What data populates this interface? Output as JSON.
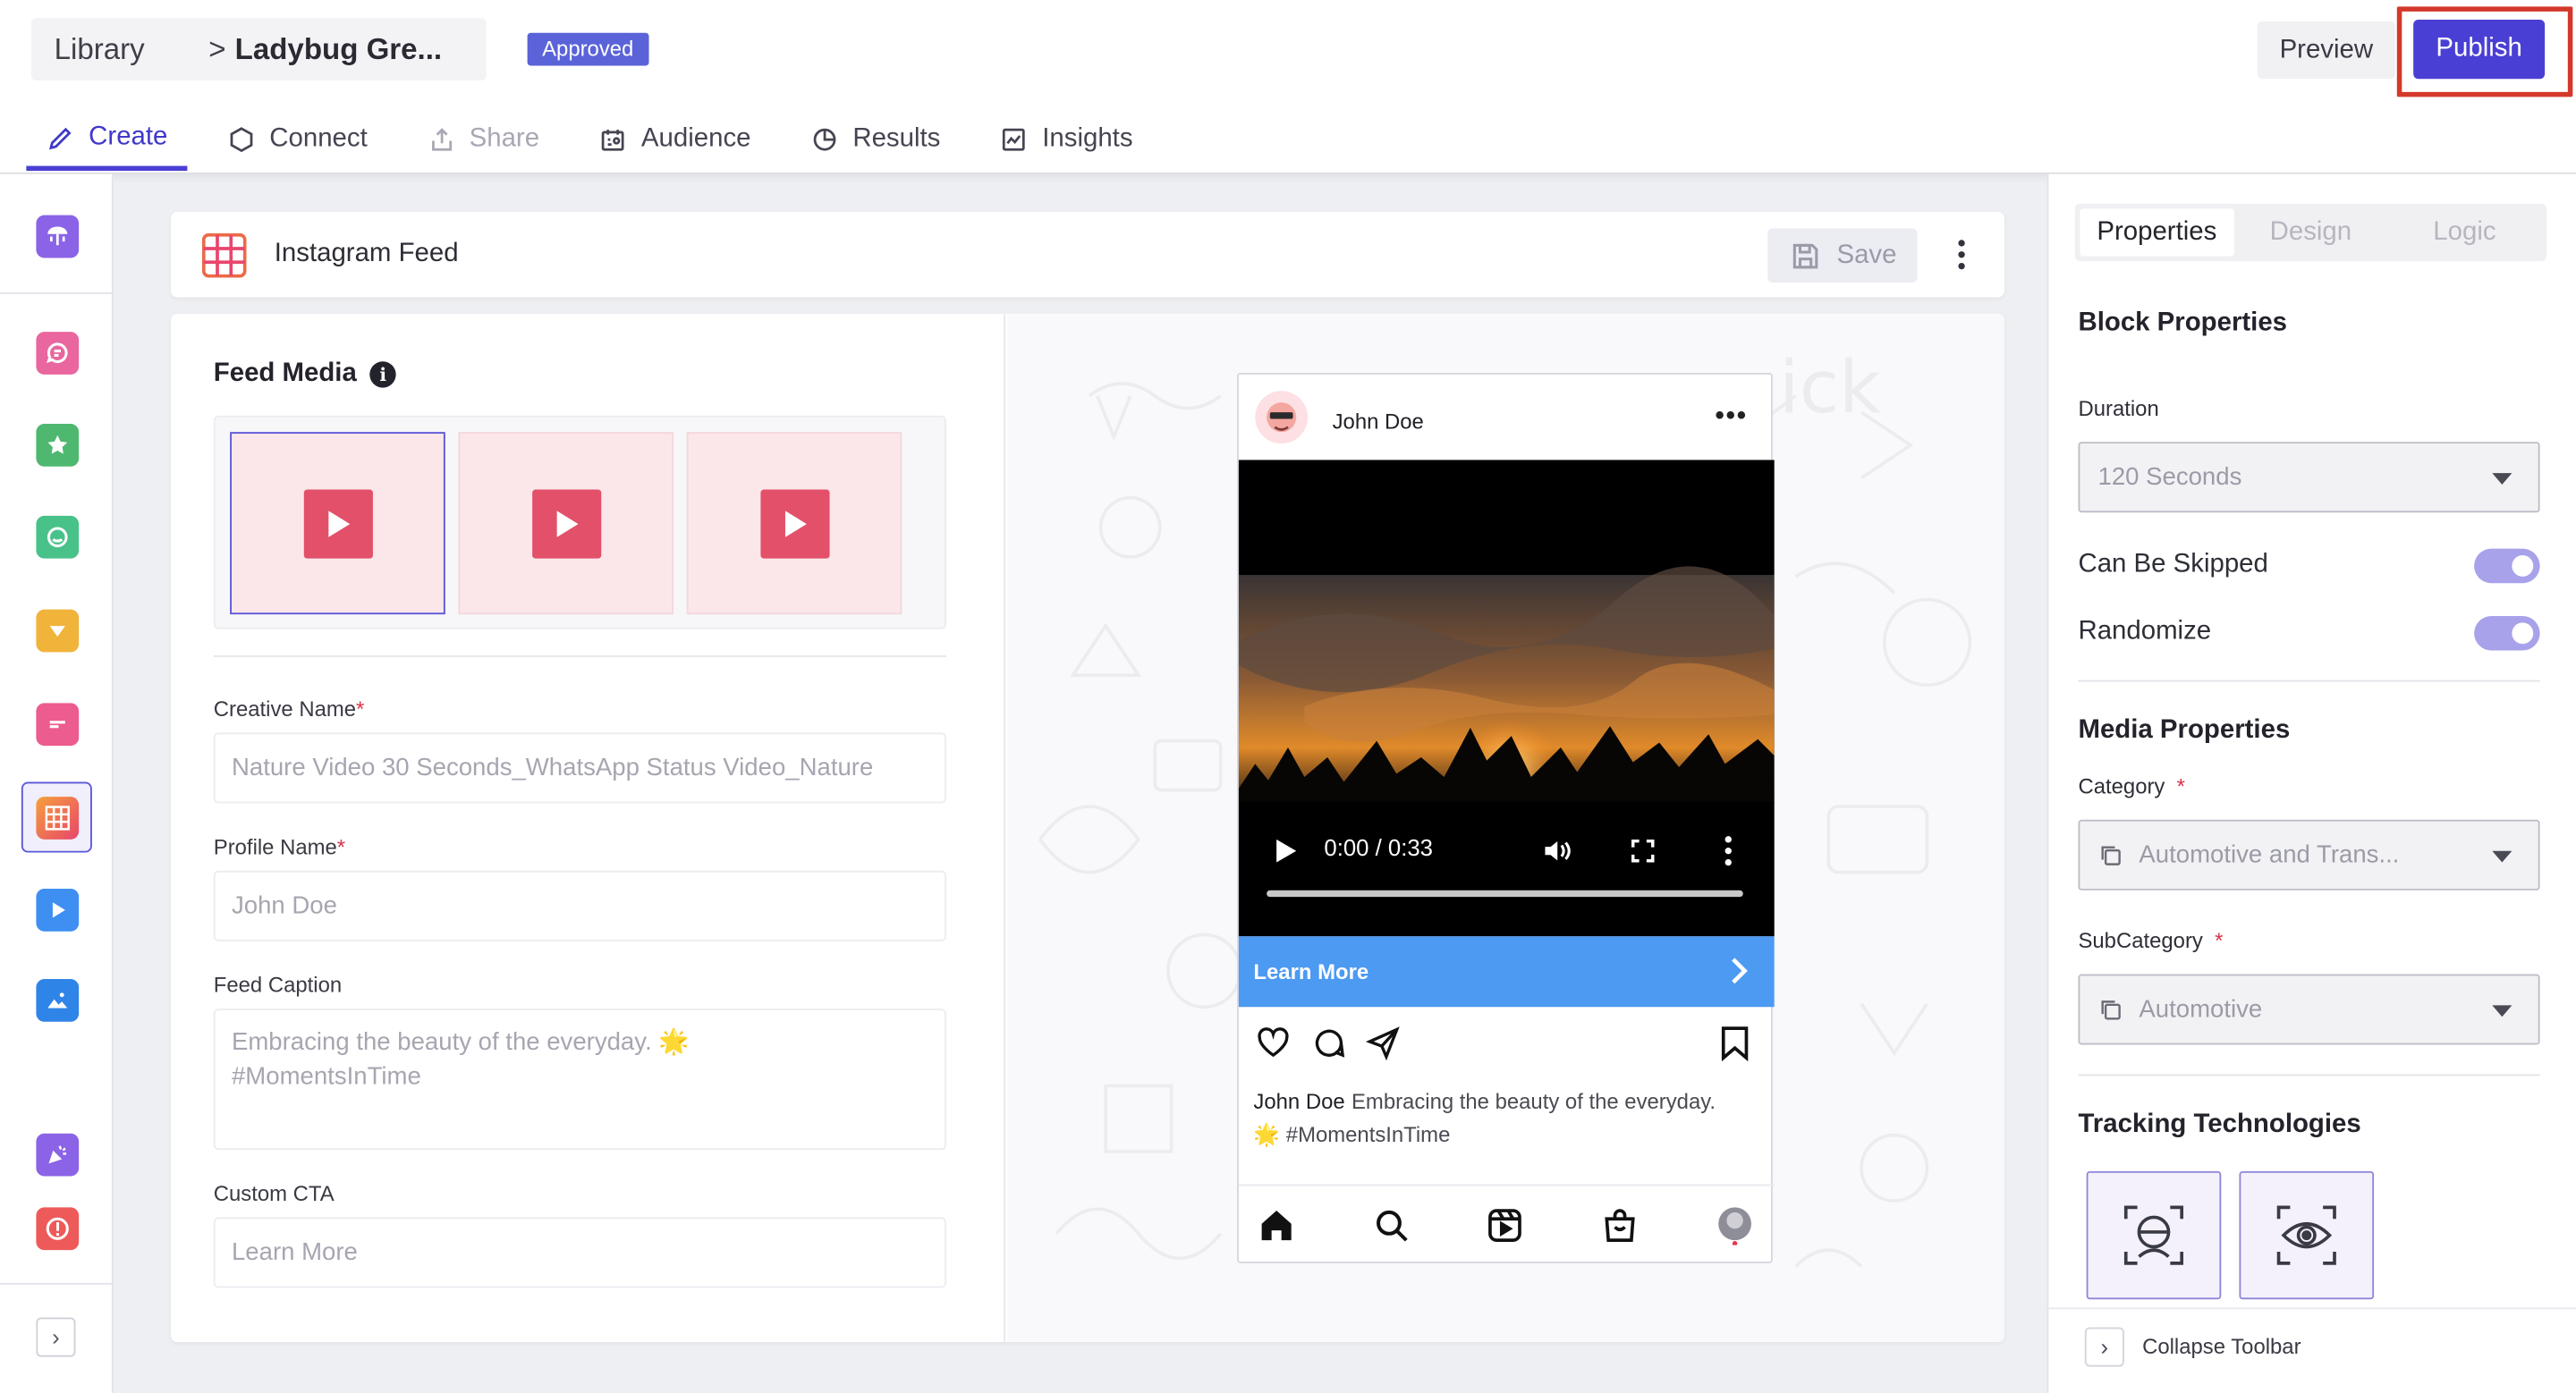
{
  "header": {
    "breadcrumb_root": "Library",
    "breadcrumb_separator": ">",
    "breadcrumb_current": "Ladybug Gre...",
    "status": "Approved",
    "preview_label": "Preview",
    "publish_label": "Publish"
  },
  "tabs": [
    {
      "label": "Create",
      "icon": "pencil-icon",
      "state": "active"
    },
    {
      "label": "Connect",
      "icon": "hexagon-icon",
      "state": "normal"
    },
    {
      "label": "Share",
      "icon": "share-icon",
      "state": "disabled"
    },
    {
      "label": "Audience",
      "icon": "audience-icon",
      "state": "normal"
    },
    {
      "label": "Results",
      "icon": "pie-chart-icon",
      "state": "normal"
    },
    {
      "label": "Insights",
      "icon": "insights-chart-icon",
      "state": "normal"
    }
  ],
  "block": {
    "title": "Instagram Feed",
    "save_label": "Save"
  },
  "form": {
    "feed_media_title": "Feed Media",
    "info_glyph": "i",
    "creative_name_label": "Creative Name",
    "creative_name_value": "Nature Video 30 Seconds_WhatsApp Status Video_Nature",
    "profile_name_label": "Profile Name",
    "profile_name_value": "John Doe",
    "feed_caption_label": "Feed Caption",
    "feed_caption_line1": "Embracing the beauty of the everyday. 🌟",
    "feed_caption_line2": "#MomentsInTime",
    "custom_cta_label": "Custom CTA",
    "custom_cta_value": "Learn More",
    "required_mark": "*"
  },
  "preview": {
    "username": "John Doe",
    "more_glyph": "•••",
    "video_time": "0:00 / 0:33",
    "cta_label": "Learn More",
    "caption_user": "John Doe",
    "caption_text": "Embracing the beauty of the everyday.",
    "caption_line2": "🌟 #MomentsInTime"
  },
  "properties": {
    "tabs": [
      "Properties",
      "Design",
      "Logic"
    ],
    "block_properties_title": "Block Properties",
    "duration_label": "Duration",
    "duration_value": "120 Seconds",
    "can_be_skipped_label": "Can Be Skipped",
    "can_be_skipped": true,
    "randomize_label": "Randomize",
    "randomize": true,
    "media_properties_title": "Media Properties",
    "category_label": "Category",
    "category_value": "Automotive and Trans...",
    "subcategory_label": "SubCategory",
    "subcategory_value": "Automotive",
    "tracking_title": "Tracking Technologies",
    "collapse_label": "Collapse Toolbar"
  },
  "colors": {
    "accent": "#4a3fd4",
    "publish_highlight": "#d3382a",
    "cta_blue": "#4c9af2",
    "media_red": "#e3506a"
  }
}
